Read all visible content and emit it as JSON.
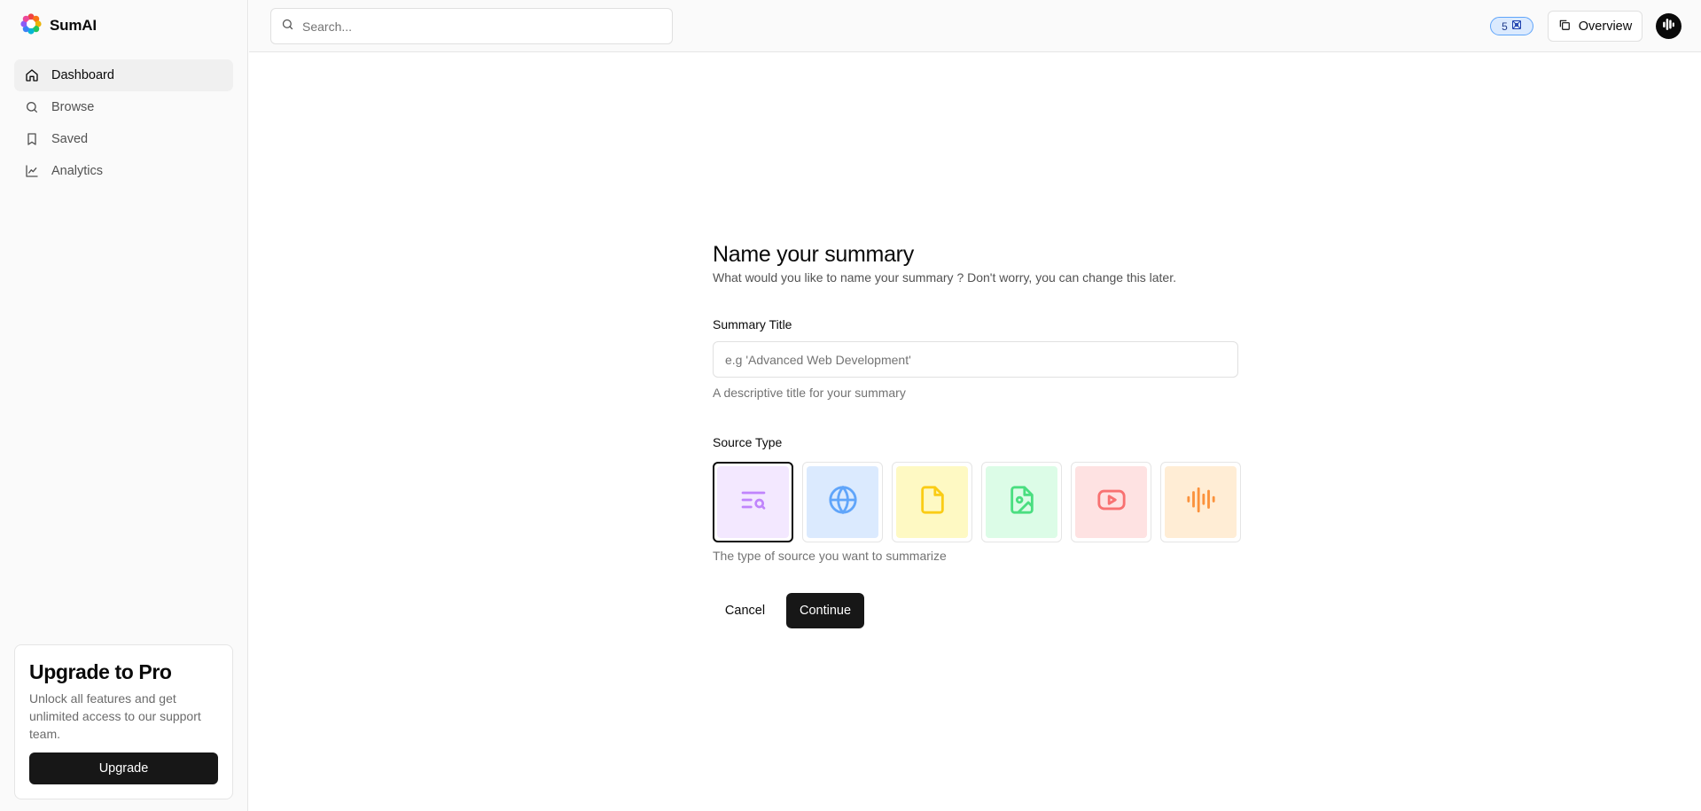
{
  "app": {
    "name": "SumAI"
  },
  "sidebar": {
    "items": [
      {
        "label": "Dashboard",
        "icon": "home-icon",
        "active": true
      },
      {
        "label": "Browse",
        "icon": "search-icon",
        "active": false
      },
      {
        "label": "Saved",
        "icon": "bookmark-icon",
        "active": false
      },
      {
        "label": "Analytics",
        "icon": "chart-line-icon",
        "active": false
      }
    ],
    "upgrade": {
      "title": "Upgrade to Pro",
      "description": "Unlock all features and get unlimited access to our support team.",
      "button_label": "Upgrade"
    }
  },
  "header": {
    "search_placeholder": "Search...",
    "credits": "5",
    "overview_label": "Overview"
  },
  "form": {
    "title": "Name your summary",
    "subtitle": "What would you like to name your summary ? Don't worry, you can change this later.",
    "summary_title_label": "Summary Title",
    "summary_title_value": "",
    "summary_title_placeholder": "e.g 'Advanced Web Development'",
    "summary_title_help": "A descriptive title for your summary",
    "source_type_label": "Source Type",
    "source_types": [
      {
        "icon": "text-search-icon",
        "bg": "#f3e8ff",
        "color": "#c084fc",
        "selected": true
      },
      {
        "icon": "globe-icon",
        "bg": "#dbeafe",
        "color": "#60a5fa",
        "selected": false
      },
      {
        "icon": "file-icon",
        "bg": "#fef9c3",
        "color": "#facc15",
        "selected": false
      },
      {
        "icon": "file-image-icon",
        "bg": "#dcfce7",
        "color": "#4ade80",
        "selected": false
      },
      {
        "icon": "youtube-icon",
        "bg": "#fee2e2",
        "color": "#f87171",
        "selected": false
      },
      {
        "icon": "audio-lines-icon",
        "bg": "#ffedd5",
        "color": "#fb923c",
        "selected": false
      }
    ],
    "source_type_help": "The type of source you want to summarize",
    "cancel_label": "Cancel",
    "continue_label": "Continue"
  }
}
